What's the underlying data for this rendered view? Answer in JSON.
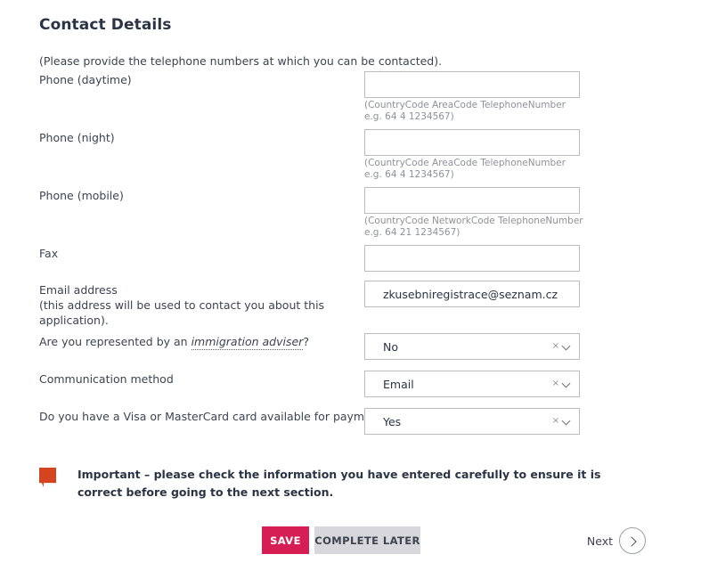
{
  "page": {
    "title": "Contact Details",
    "intro": "(Please provide the telephone numbers at which you can be contacted)."
  },
  "fields": {
    "phone_daytime": {
      "label": "Phone (daytime)",
      "value": "",
      "hint": "(CountryCode AreaCode TelephoneNumber e.g. 64 4 1234567)"
    },
    "phone_night": {
      "label": "Phone (night)",
      "value": "",
      "hint": "(CountryCode AreaCode TelephoneNumber e.g. 64 4 1234567)"
    },
    "phone_mobile": {
      "label": "Phone (mobile)",
      "value": "",
      "hint": "(CountryCode NetworkCode TelephoneNumber e.g. 64 21 1234567)"
    },
    "fax": {
      "label": "Fax",
      "value": ""
    },
    "email": {
      "label": "Email address\n(this address will be used to contact you about this application).",
      "value": "zkusebniregistrace@seznam.cz"
    },
    "immigration_adviser": {
      "label_before": "Are you represented by an ",
      "label_link": "immigration adviser",
      "label_after": "?",
      "value": "No",
      "clear_icon": "×",
      "chevron_icon": "chevron-down"
    },
    "communication_method": {
      "label": "Communication method",
      "value": "Email",
      "clear_icon": "×",
      "chevron_icon": "chevron-down"
    },
    "card_payment": {
      "label": "Do you have a Visa or MasterCard card available for payment?",
      "value": "Yes",
      "clear_icon": "×",
      "chevron_icon": "chevron-down"
    }
  },
  "notice": {
    "icon": "flag-icon",
    "text": "Important – please check the information you have entered carefully to ensure it is correct before going to the next section."
  },
  "buttons": {
    "save": "SAVE",
    "complete_later": "COMPLETE LATER",
    "next": "Next",
    "next_icon": "chevron-right-icon"
  },
  "colors": {
    "save_bg": "#d61e55",
    "complete_later_bg": "#d8d8dc",
    "notice_icon": "#d4451f",
    "text": "#3c4450",
    "hint": "#8d9199",
    "border": "#b9bcc2"
  }
}
